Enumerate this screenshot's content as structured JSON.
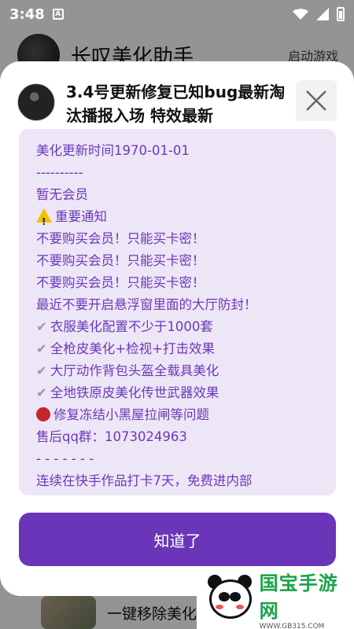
{
  "status_bar": {
    "time": "3:48",
    "notification_icon": "A"
  },
  "background": {
    "title": "长叹美化助手",
    "launch_label": "启动游戏",
    "bottom_item_text": "一键移除美化"
  },
  "dialog": {
    "title": "3.4号更新修复已知bug最新淘汰播报入场 特效最新",
    "notice_lines": [
      "美化更新时间1970-01-01",
      "----------",
      "暂无会员",
      "重要通知",
      "不要购买会员！只能买卡密！",
      "不要购买会员！只能买卡密！",
      "不要购买会员！只能买卡密！",
      "最近不要开启悬浮窗里面的大厅防封！",
      "衣服美化配置不少于1000套",
      "全枪皮美化+检视+打击效果",
      "大厅动作背包头盔全载具美化",
      "全地铁原皮美化传世武器效果",
      "修复冻结小黑屋拉闸等问题",
      "售后qq群：1073024963",
      "- - - - - - -",
      "连续在快手作品打卡7天，免费进内部"
    ],
    "ok_label": "知道了"
  },
  "watermark": {
    "title": "国宝手游网",
    "url": "WWW.GB315.COM"
  },
  "colors": {
    "accent": "#6a35b8",
    "notice_bg": "#ede6f6",
    "notice_text": "#6b39b8"
  }
}
